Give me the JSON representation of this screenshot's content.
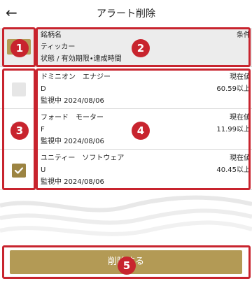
{
  "header": {
    "back_glyph": "←",
    "title": "アラート削除"
  },
  "table_header": {
    "col1_line1": "銘柄名",
    "col1_line2": "ティッカー",
    "col1_line3": "状態 / 有効期限•達成時間",
    "col2": "条件"
  },
  "rows": [
    {
      "name": "ドミニオン　エナジー",
      "ticker": "D",
      "status": "監視中 2024/08/06",
      "condition_label": "現在値",
      "condition_value": "60.59以上",
      "checked": false
    },
    {
      "name": "フォード　モーター",
      "ticker": "F",
      "status": "監視中 2024/08/06",
      "condition_label": "現在値",
      "condition_value": "11.99以上",
      "checked": false
    },
    {
      "name": "ユニティー　ソフトウェア",
      "ticker": "U",
      "status": "監視中 2024/08/06",
      "condition_label": "現在値",
      "condition_value": "40.45以上",
      "checked": true
    }
  ],
  "footer": {
    "delete_label": "削除する"
  },
  "callouts": [
    "1",
    "2",
    "3",
    "4",
    "5"
  ],
  "colors": {
    "accent": "#b39a55",
    "checked": "#9c8442",
    "callout": "#c8242e"
  }
}
